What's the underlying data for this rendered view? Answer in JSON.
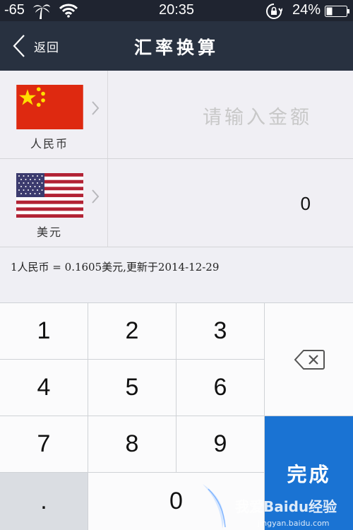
{
  "status_bar": {
    "signal": "-65",
    "time": "20:35",
    "battery": "24%",
    "icons": [
      "palm-tree-icon",
      "wifi-icon",
      "rotation-lock-icon",
      "battery-icon"
    ]
  },
  "nav": {
    "back_label": "返回",
    "title": "汇率换算"
  },
  "from_currency": {
    "name": "人民币",
    "flag": "china-flag",
    "amount_placeholder": "请输入金额"
  },
  "to_currency": {
    "name": "美元",
    "flag": "usa-flag",
    "value": "0"
  },
  "rate_text": "1人民币 = 0.1605美元,更新于2014-12-29",
  "keypad": {
    "k1": "1",
    "k2": "2",
    "k3": "3",
    "k4": "4",
    "k5": "5",
    "k6": "6",
    "k7": "7",
    "k8": "8",
    "k9": "9",
    "dot": ".",
    "k0": "0",
    "done": "完成",
    "backspace_icon": "backspace-icon"
  },
  "watermark": {
    "brand": "我爱Baidu经验",
    "url": "jingyan.baidu.com"
  },
  "colors": {
    "nav_bg": "#283140",
    "done_button": "#1a73d3",
    "china_red": "#de2910",
    "china_gold": "#ffde00",
    "usa_red": "#b22234",
    "usa_blue": "#3c3b6e"
  }
}
